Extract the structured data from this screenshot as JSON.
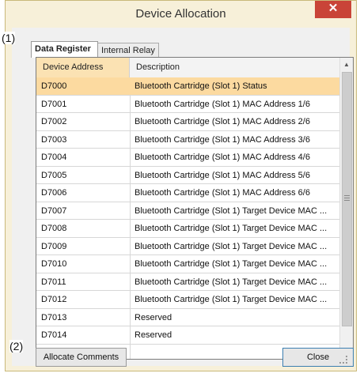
{
  "window": {
    "title": "Device Allocation",
    "close_glyph": "✕"
  },
  "tabs": [
    {
      "label": "Data Register",
      "active": true
    },
    {
      "label": "Internal Relay",
      "active": false
    }
  ],
  "table": {
    "columns": [
      "Device Address",
      "Description"
    ],
    "rows": [
      {
        "address": "D7000",
        "description": "Bluetooth Cartridge (Slot 1) Status",
        "selected": true
      },
      {
        "address": "D7001",
        "description": "Bluetooth Cartridge (Slot 1) MAC Address 1/6"
      },
      {
        "address": "D7002",
        "description": "Bluetooth Cartridge (Slot 1) MAC Address 2/6"
      },
      {
        "address": "D7003",
        "description": "Bluetooth Cartridge (Slot 1) MAC Address 3/6"
      },
      {
        "address": "D7004",
        "description": "Bluetooth Cartridge (Slot 1) MAC Address 4/6"
      },
      {
        "address": "D7005",
        "description": "Bluetooth Cartridge (Slot 1) MAC Address 5/6"
      },
      {
        "address": "D7006",
        "description": "Bluetooth Cartridge (Slot 1) MAC Address 6/6"
      },
      {
        "address": "D7007",
        "description": "Bluetooth Cartridge (Slot 1) Target Device MAC ..."
      },
      {
        "address": "D7008",
        "description": "Bluetooth Cartridge (Slot 1) Target Device MAC ..."
      },
      {
        "address": "D7009",
        "description": "Bluetooth Cartridge (Slot 1) Target Device MAC ..."
      },
      {
        "address": "D7010",
        "description": "Bluetooth Cartridge (Slot 1) Target Device MAC ..."
      },
      {
        "address": "D7011",
        "description": "Bluetooth Cartridge (Slot 1) Target Device MAC ..."
      },
      {
        "address": "D7012",
        "description": "Bluetooth Cartridge (Slot 1) Target Device MAC ..."
      },
      {
        "address": "D7013",
        "description": "Reserved"
      },
      {
        "address": "D7014",
        "description": "Reserved"
      }
    ]
  },
  "buttons": {
    "allocate": "Allocate Comments",
    "close": "Close"
  },
  "callouts": {
    "one": "(1)",
    "two": "(2)"
  },
  "colors": {
    "selected_row": "#fcdaa0",
    "header_active": "#fbe2b3",
    "close_x": "#c94438"
  }
}
